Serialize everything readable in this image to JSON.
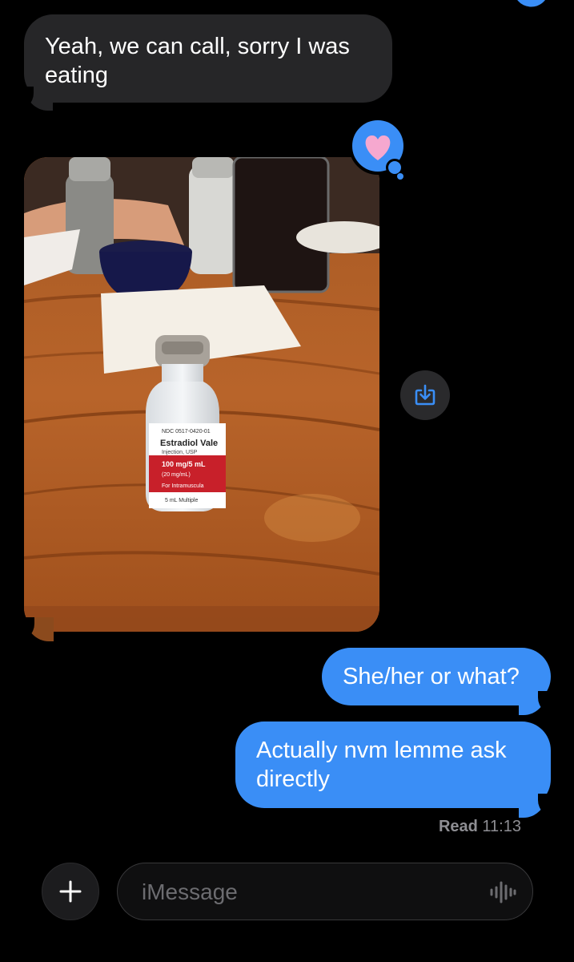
{
  "messages": [
    {
      "direction": "incoming",
      "text": "Yeah, we can call, sorry I was eating"
    },
    {
      "direction": "incoming",
      "type": "photo",
      "tapback": "heart",
      "icon": "photo-of-medication-vial"
    },
    {
      "direction": "outgoing",
      "text": "She/her or what?"
    },
    {
      "direction": "outgoing",
      "text": "Actually nvm lemme ask directly"
    }
  ],
  "photo_text": {
    "ndc": "NDC 0517-0420-01",
    "drug": "Estradiol Vale",
    "form": "Injection, USP",
    "strength": "100 mg/5 mL",
    "concentration": "(20 mg/mL)",
    "route": "For Intramuscula",
    "volume": "5 mL Multiple"
  },
  "read_receipt": {
    "label": "Read",
    "time": "11:13"
  },
  "composer": {
    "placeholder": "iMessage"
  },
  "colors": {
    "outgoing": "#3a8ef6",
    "incoming": "#262628",
    "background": "#000000"
  },
  "icons": {
    "tapback": "heart-icon",
    "save": "save-download-icon",
    "plus": "plus-icon",
    "audio": "waveform-icon"
  }
}
